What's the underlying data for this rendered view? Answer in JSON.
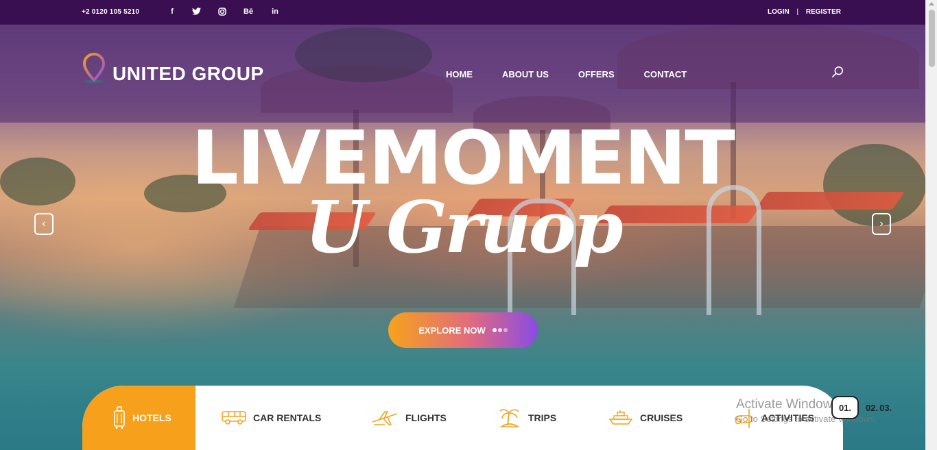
{
  "topbar": {
    "phone": "+2 0120 105 5210",
    "social": [
      "facebook-icon",
      "twitter-icon",
      "instagram-icon",
      "behance-icon",
      "linkedin-icon"
    ],
    "social_glyphs": {
      "facebook": "f",
      "behance": "Bē",
      "linkedin": "in"
    },
    "login": "LOGIN",
    "separator": "|",
    "register": "REGISTER"
  },
  "header": {
    "brand": "UNITED GROUP",
    "nav": [
      "HOME",
      "ABOUT US",
      "OFFERS",
      "CONTACT"
    ]
  },
  "hero": {
    "title": "LIVEMOMENT",
    "script_title": "U Gruop",
    "cta": "EXPLORE NOW",
    "prev_arrow": "‹",
    "next_arrow": "›"
  },
  "tabs": [
    {
      "label": "HOTELS",
      "icon": "luggage-icon",
      "active": true
    },
    {
      "label": "CAR RENTALS",
      "icon": "bus-icon",
      "active": false
    },
    {
      "label": "FLIGHTS",
      "icon": "airplane-icon",
      "active": false
    },
    {
      "label": "TRIPS",
      "icon": "palm-island-icon",
      "active": false
    },
    {
      "label": "CRUISES",
      "icon": "ship-icon",
      "active": false
    },
    {
      "label": "ACTIVITIES",
      "icon": "activities-icon",
      "active": false
    }
  ],
  "pager": {
    "current": "01.",
    "items": [
      "02.",
      "03."
    ]
  },
  "watermark": {
    "title": "Activate Windows",
    "subtitle": "Go to Settings to activate Windows."
  },
  "colors": {
    "topbar": "#3a0f52",
    "accent_orange": "#f7a01b",
    "accent_purple": "#8a4be6"
  }
}
